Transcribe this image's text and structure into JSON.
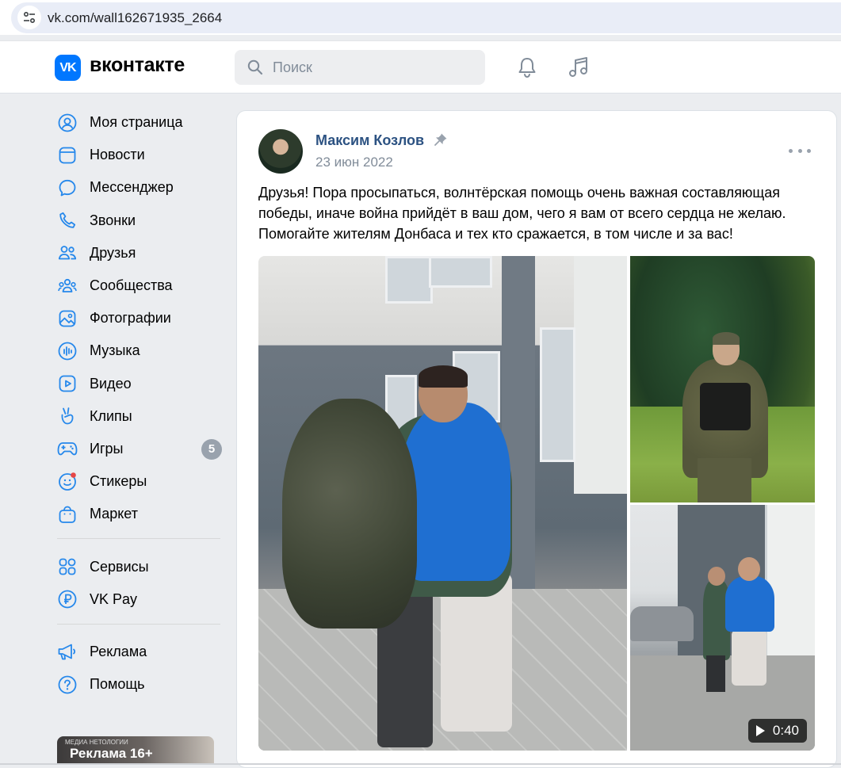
{
  "browser": {
    "url": "vk.com/wall162671935_2664"
  },
  "header": {
    "logo_text": "вконтакте",
    "logo_mark": "VK",
    "search_placeholder": "Поиск",
    "brand_color": "#0077ff"
  },
  "sidebar": {
    "items": [
      {
        "label": "Моя страница",
        "icon": "user-circle-icon"
      },
      {
        "label": "Новости",
        "icon": "news-icon"
      },
      {
        "label": "Мессенджер",
        "icon": "message-bubble-icon"
      },
      {
        "label": "Звонки",
        "icon": "phone-icon"
      },
      {
        "label": "Друзья",
        "icon": "friends-icon"
      },
      {
        "label": "Сообщества",
        "icon": "communities-icon"
      },
      {
        "label": "Фотографии",
        "icon": "photo-icon"
      },
      {
        "label": "Музыка",
        "icon": "music-icon"
      },
      {
        "label": "Видео",
        "icon": "video-icon"
      },
      {
        "label": "Клипы",
        "icon": "clips-icon"
      },
      {
        "label": "Игры",
        "icon": "gamepad-icon",
        "badge": "5"
      },
      {
        "label": "Стикеры",
        "icon": "sticker-icon"
      },
      {
        "label": "Маркет",
        "icon": "market-bag-icon"
      }
    ],
    "items2": [
      {
        "label": "Сервисы",
        "icon": "services-grid-icon"
      },
      {
        "label": "VK Pay",
        "icon": "vkpay-icon"
      }
    ],
    "items3": [
      {
        "label": "Реклама",
        "icon": "megaphone-icon"
      },
      {
        "label": "Помощь",
        "icon": "help-icon"
      }
    ],
    "ad_label": "Реклама 16+",
    "ad_small": "МЕДИА НЕТОЛОГИИ"
  },
  "post": {
    "author": "Максим Козлов",
    "date": "23 июн 2022",
    "text": "Друзья! Пора просыпаться, волнтёрская помощь очень важная составляющая победы, иначе война прийдёт в ваш дом, чего я вам от всего сердца не желаю. Помогайте жителям Донбаса и тех кто сражается, в том числе и за вас!",
    "video_duration": "0:40",
    "link_color": "#2a5885"
  }
}
